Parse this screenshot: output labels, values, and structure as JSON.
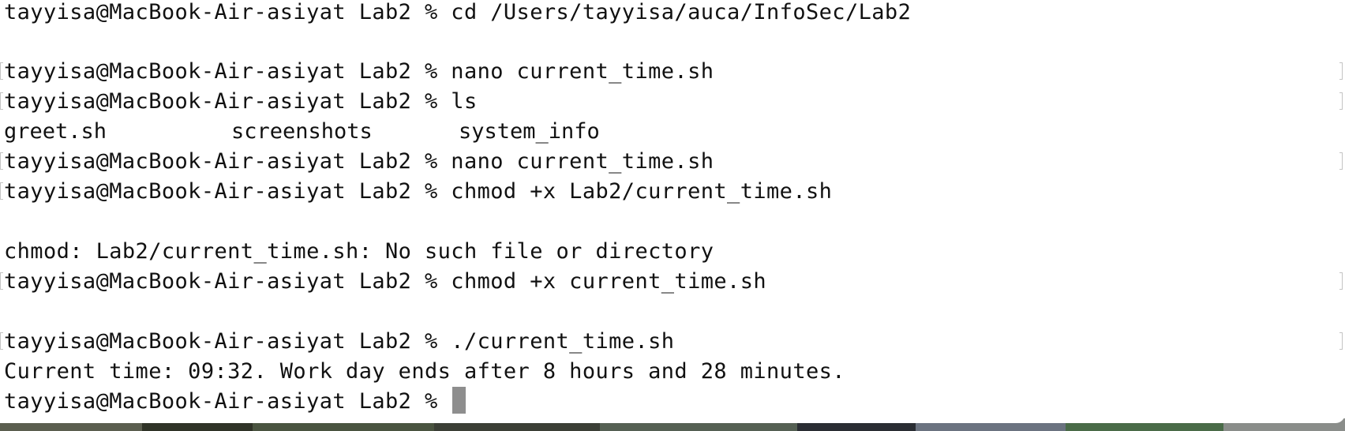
{
  "terminal": {
    "lines": [
      "tayyisa@MacBook-Air-asiyat Lab2 % cd /Users/tayyisa/auca/InfoSec/Lab2",
      "tayyisa@MacBook-Air-asiyat Lab2 % nano current_time.sh",
      "tayyisa@MacBook-Air-asiyat Lab2 % ls",
      "tayyisa@MacBook-Air-asiyat Lab2 % nano current_time.sh",
      "tayyisa@MacBook-Air-asiyat Lab2 % chmod +x Lab2/current_time.sh",
      "chmod: Lab2/current_time.sh: No such file or directory",
      "tayyisa@MacBook-Air-asiyat Lab2 % chmod +x current_time.sh",
      "tayyisa@MacBook-Air-asiyat Lab2 % ./current_time.sh",
      "Current time: 09:32. Work day ends after 8 hours and 28 minutes.",
      "tayyisa@MacBook-Air-asiyat Lab2 % "
    ],
    "ls_output": [
      "greet.sh",
      "screenshots",
      "system_info"
    ]
  },
  "colors": {
    "background": "#ffffff",
    "text": "#111111",
    "cursor": "#8e8e8e"
  }
}
